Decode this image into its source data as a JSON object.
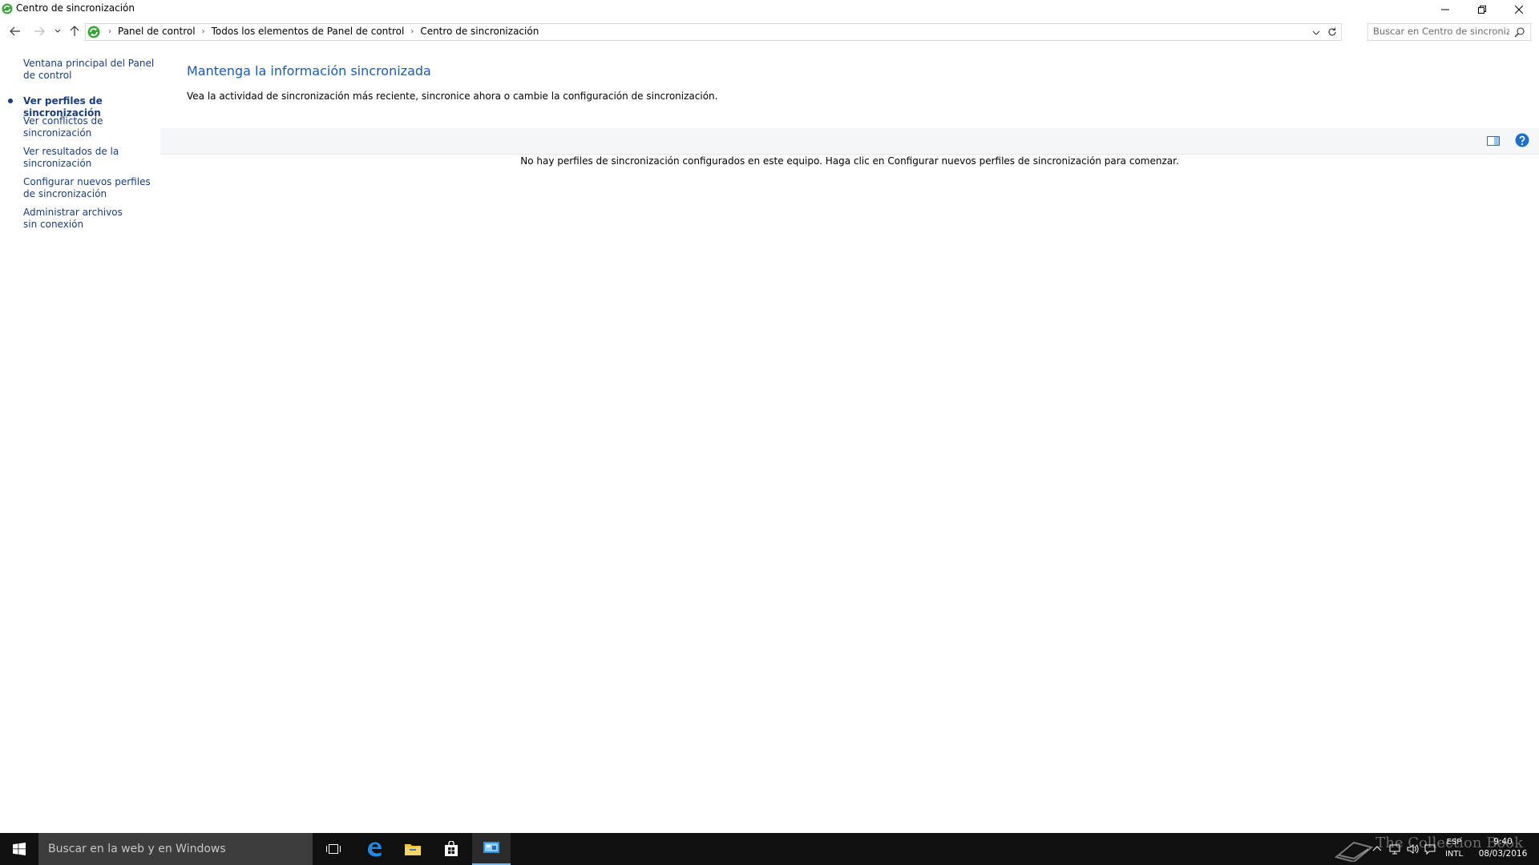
{
  "window": {
    "title": "Centro de sincronización"
  },
  "address_bar": {
    "crumbs": [
      "Panel de control",
      "Todos los elementos de Panel de control",
      "Centro de sincronización"
    ],
    "search_placeholder": "Buscar en Centro de sincroniz..."
  },
  "sidebar": {
    "home_link": "Ventana principal del Panel de control",
    "items": [
      {
        "label": "Ver perfiles de sincronización",
        "active": true
      },
      {
        "label": "Ver conflictos de sincronización",
        "active": false
      },
      {
        "label": "Ver resultados de la sincronización",
        "active": false
      },
      {
        "label": "Configurar nuevos perfiles de sincronización",
        "active": false
      },
      {
        "label": "Administrar archivos sin conexión",
        "active": false
      }
    ]
  },
  "main": {
    "title": "Mantenga la información sincronizada",
    "description": "Vea la actividad de sincronización más reciente, sincronice ahora o cambie la configuración de sincronización.",
    "empty_message": "No hay perfiles de sincronización configurados en este equipo. Haga clic en Configurar nuevos perfiles de sincronización para comenzar."
  },
  "taskbar": {
    "search_placeholder": "Buscar en la web y en Windows",
    "apps": [
      "task-view",
      "edge",
      "file-explorer",
      "store",
      "sync-center"
    ],
    "language_top": "ESP",
    "language_bottom": "INTL",
    "time": "9:40",
    "date": "08/03/2016",
    "watermark": "The Collection Book"
  },
  "colors": {
    "link": "#1a3e78",
    "heading": "#1e5aa8",
    "taskbar": "#101010",
    "taskbar_search": "#3c3c3c",
    "accent": "#76b9ed"
  }
}
